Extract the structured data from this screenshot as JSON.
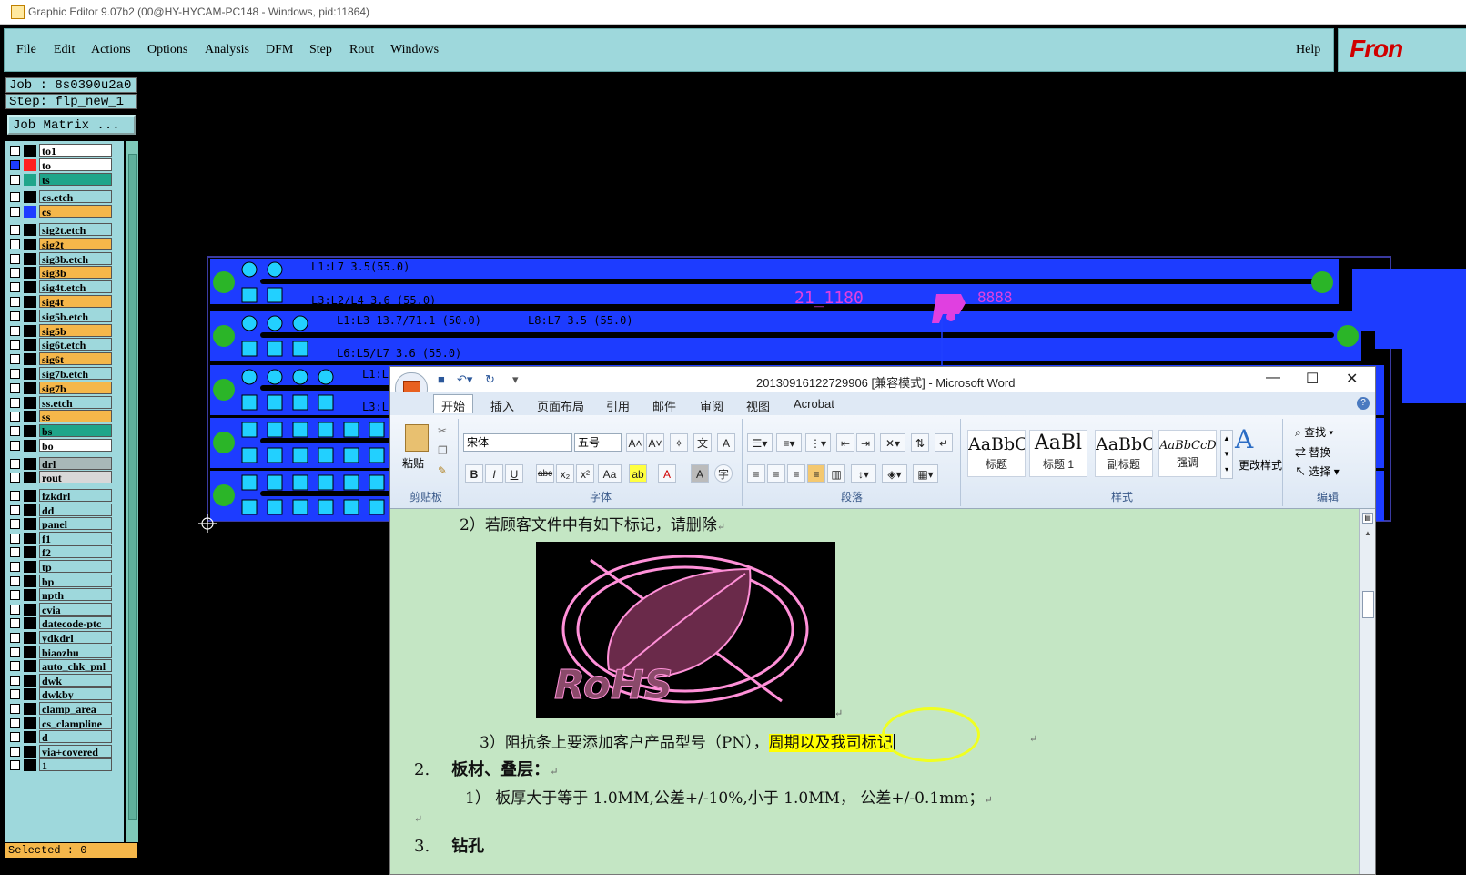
{
  "titlebar": {
    "title": "Graphic Editor 9.07b2 (00@HY-HYCAM-PC148 - Windows, pid:11864)"
  },
  "menu": {
    "items": [
      "File",
      "Edit",
      "Actions",
      "Options",
      "Analysis",
      "DFM",
      "Step",
      "Rout",
      "Windows"
    ],
    "help": "Help",
    "logo": "Fron"
  },
  "job": {
    "job": "Job : 8s0390u2a0",
    "step": "Step: flp_new_1",
    "matrix": "Job Matrix ..."
  },
  "layers": [
    {
      "name": "to1",
      "bg": "#ffffff",
      "swatch": ""
    },
    {
      "name": "to",
      "bg": "#ffffff",
      "swatch": "#ff2020",
      "active": true
    },
    {
      "name": "ts",
      "bg": "#1fa58a",
      "swatch": "#1fa58a"
    },
    {
      "name": "cs.etch",
      "bg": "#9ed8dc",
      "swatch": ""
    },
    {
      "name": "cs",
      "bg": "#f5b74a",
      "swatch": "#1d3cff"
    },
    {
      "name": "sig2t.etch",
      "bg": "#9ed8dc",
      "swatch": ""
    },
    {
      "name": "sig2t",
      "bg": "#f5b74a",
      "swatch": ""
    },
    {
      "name": "sig3b.etch",
      "bg": "#9ed8dc",
      "swatch": ""
    },
    {
      "name": "sig3b",
      "bg": "#f5b74a",
      "swatch": ""
    },
    {
      "name": "sig4t.etch",
      "bg": "#9ed8dc",
      "swatch": ""
    },
    {
      "name": "sig4t",
      "bg": "#f5b74a",
      "swatch": ""
    },
    {
      "name": "sig5b.etch",
      "bg": "#9ed8dc",
      "swatch": ""
    },
    {
      "name": "sig5b",
      "bg": "#f5b74a",
      "swatch": ""
    },
    {
      "name": "sig6t.etch",
      "bg": "#9ed8dc",
      "swatch": ""
    },
    {
      "name": "sig6t",
      "bg": "#f5b74a",
      "swatch": ""
    },
    {
      "name": "sig7b.etch",
      "bg": "#9ed8dc",
      "swatch": ""
    },
    {
      "name": "sig7b",
      "bg": "#f5b74a",
      "swatch": ""
    },
    {
      "name": "ss.etch",
      "bg": "#9ed8dc",
      "swatch": ""
    },
    {
      "name": "ss",
      "bg": "#f5b74a",
      "swatch": ""
    },
    {
      "name": "bs",
      "bg": "#1fa58a",
      "swatch": ""
    },
    {
      "name": "bo",
      "bg": "#ffffff",
      "swatch": ""
    },
    {
      "name": "drl",
      "bg": "#a8b8b8",
      "swatch": ""
    },
    {
      "name": "rout",
      "bg": "#d8d8d8",
      "swatch": ""
    },
    {
      "name": "fzkdrl",
      "bg": "#9ed8dc",
      "swatch": ""
    },
    {
      "name": "dd",
      "bg": "#9ed8dc",
      "swatch": ""
    },
    {
      "name": "panel",
      "bg": "#9ed8dc",
      "swatch": ""
    },
    {
      "name": "f1",
      "bg": "#9ed8dc",
      "swatch": ""
    },
    {
      "name": "f2",
      "bg": "#9ed8dc",
      "swatch": ""
    },
    {
      "name": "tp",
      "bg": "#9ed8dc",
      "swatch": ""
    },
    {
      "name": "bp",
      "bg": "#9ed8dc",
      "swatch": ""
    },
    {
      "name": "npth",
      "bg": "#9ed8dc",
      "swatch": ""
    },
    {
      "name": "cvia",
      "bg": "#9ed8dc",
      "swatch": ""
    },
    {
      "name": "datecode-ptc",
      "bg": "#9ed8dc",
      "swatch": ""
    },
    {
      "name": "ydkdrl",
      "bg": "#9ed8dc",
      "swatch": ""
    },
    {
      "name": "biaozhu",
      "bg": "#9ed8dc",
      "swatch": ""
    },
    {
      "name": "auto_chk_pnl",
      "bg": "#9ed8dc",
      "swatch": ""
    },
    {
      "name": "dwk",
      "bg": "#9ed8dc",
      "swatch": ""
    },
    {
      "name": "dwkby",
      "bg": "#9ed8dc",
      "swatch": ""
    },
    {
      "name": "clamp_area",
      "bg": "#9ed8dc",
      "swatch": ""
    },
    {
      "name": "cs_clampline",
      "bg": "#9ed8dc",
      "swatch": ""
    },
    {
      "name": "d",
      "bg": "#9ed8dc",
      "swatch": ""
    },
    {
      "name": "via+covered",
      "bg": "#9ed8dc",
      "swatch": ""
    },
    {
      "name": "1",
      "bg": "#9ed8dc",
      "swatch": ""
    }
  ],
  "selected": "Selected : 0",
  "pcb": {
    "labels": [
      "L1:L7 3.5(55.0)",
      "L3:L2/L4 3.6 (55.0)",
      "21_1180",
      "8888",
      "L1:L3 13.7/71.1 (50.0)",
      "L8:L7 3.5 (55.0)",
      "L6:L5/L7 3.6 (55.0)",
      "L1:L",
      "L3:L"
    ]
  },
  "word": {
    "title": "20130916122729906 [兼容模式] - Microsoft Word",
    "tabs": [
      "开始",
      "插入",
      "页面布局",
      "引用",
      "邮件",
      "审阅",
      "视图",
      "Acrobat"
    ],
    "font": "宋体",
    "size": "五号",
    "groups": [
      "剪贴板",
      "字体",
      "段落",
      "样式",
      "编辑"
    ],
    "paste": "粘贴",
    "styles": [
      {
        "preview": "AaBbC",
        "name": "标题"
      },
      {
        "preview": "AaBl",
        "name": "标题 1"
      },
      {
        "preview": "AaBbC",
        "name": "副标题"
      },
      {
        "preview": "AaBbCcDc",
        "name": "强调"
      }
    ],
    "change_styles": "更改样式",
    "edit": [
      "查找",
      "替换",
      "选择"
    ],
    "doc": {
      "line1": "2）若顾客文件中有如下标记，请删除",
      "line2_pre": "3）阻抗条上要添加客户产品型号（PN），",
      "line2_hl": "周期以及我司标记",
      "line3_num": "2.",
      "line3": "板材、叠层：",
      "line4": "1） 板厚大于等于 1.0MM,公差+/-10%,小于 1.0MM， 公差+/-0.1mm；",
      "line5_num": "3.",
      "line5": "钻孔"
    }
  },
  "colors": {
    "menu_bg": "#9ed8dc",
    "pcb_blue": "#1d3cff",
    "pad": "#22d0ff",
    "fiducial": "#2bb528",
    "highlight": "#ffff00"
  }
}
